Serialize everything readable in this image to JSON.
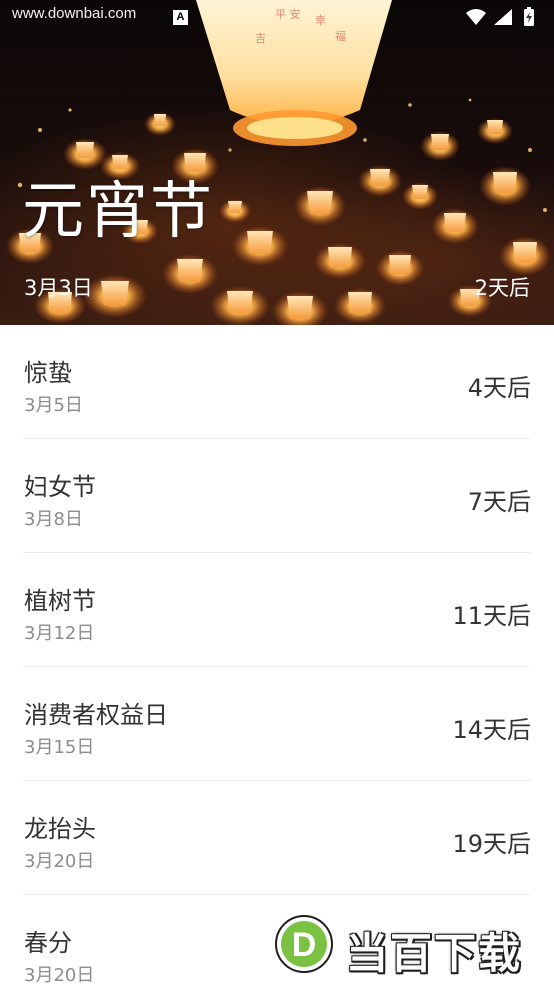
{
  "status_bar": {
    "watermark_url": "www.downbai.com",
    "notification_icon": "A",
    "icons": [
      "wifi-icon",
      "cell-signal-icon",
      "battery-charging-icon"
    ]
  },
  "featured": {
    "name": "元宵节",
    "date": "3月3日",
    "countdown": "2天后",
    "image": "sky-lanterns-night"
  },
  "events": [
    {
      "name": "惊蛰",
      "date": "3月5日",
      "countdown": "4天后"
    },
    {
      "name": "妇女节",
      "date": "3月8日",
      "countdown": "7天后"
    },
    {
      "name": "植树节",
      "date": "3月12日",
      "countdown": "11天后"
    },
    {
      "name": "消费者权益日",
      "date": "3月15日",
      "countdown": "14天后"
    },
    {
      "name": "龙抬头",
      "date": "3月20日",
      "countdown": "19天后"
    },
    {
      "name": "春分",
      "date": "3月20日",
      "countdown": ""
    }
  ],
  "brand_watermark": {
    "logo_letter": "D",
    "text": "当百下载",
    "colors": {
      "logo": "#7cc242",
      "text": "#ffffff",
      "outline": "#1e1e1e"
    }
  },
  "colors": {
    "primary_text": "#333333",
    "secondary_text": "#8c8c8c",
    "divider": "#ececec",
    "hero_text": "#ffffff"
  }
}
